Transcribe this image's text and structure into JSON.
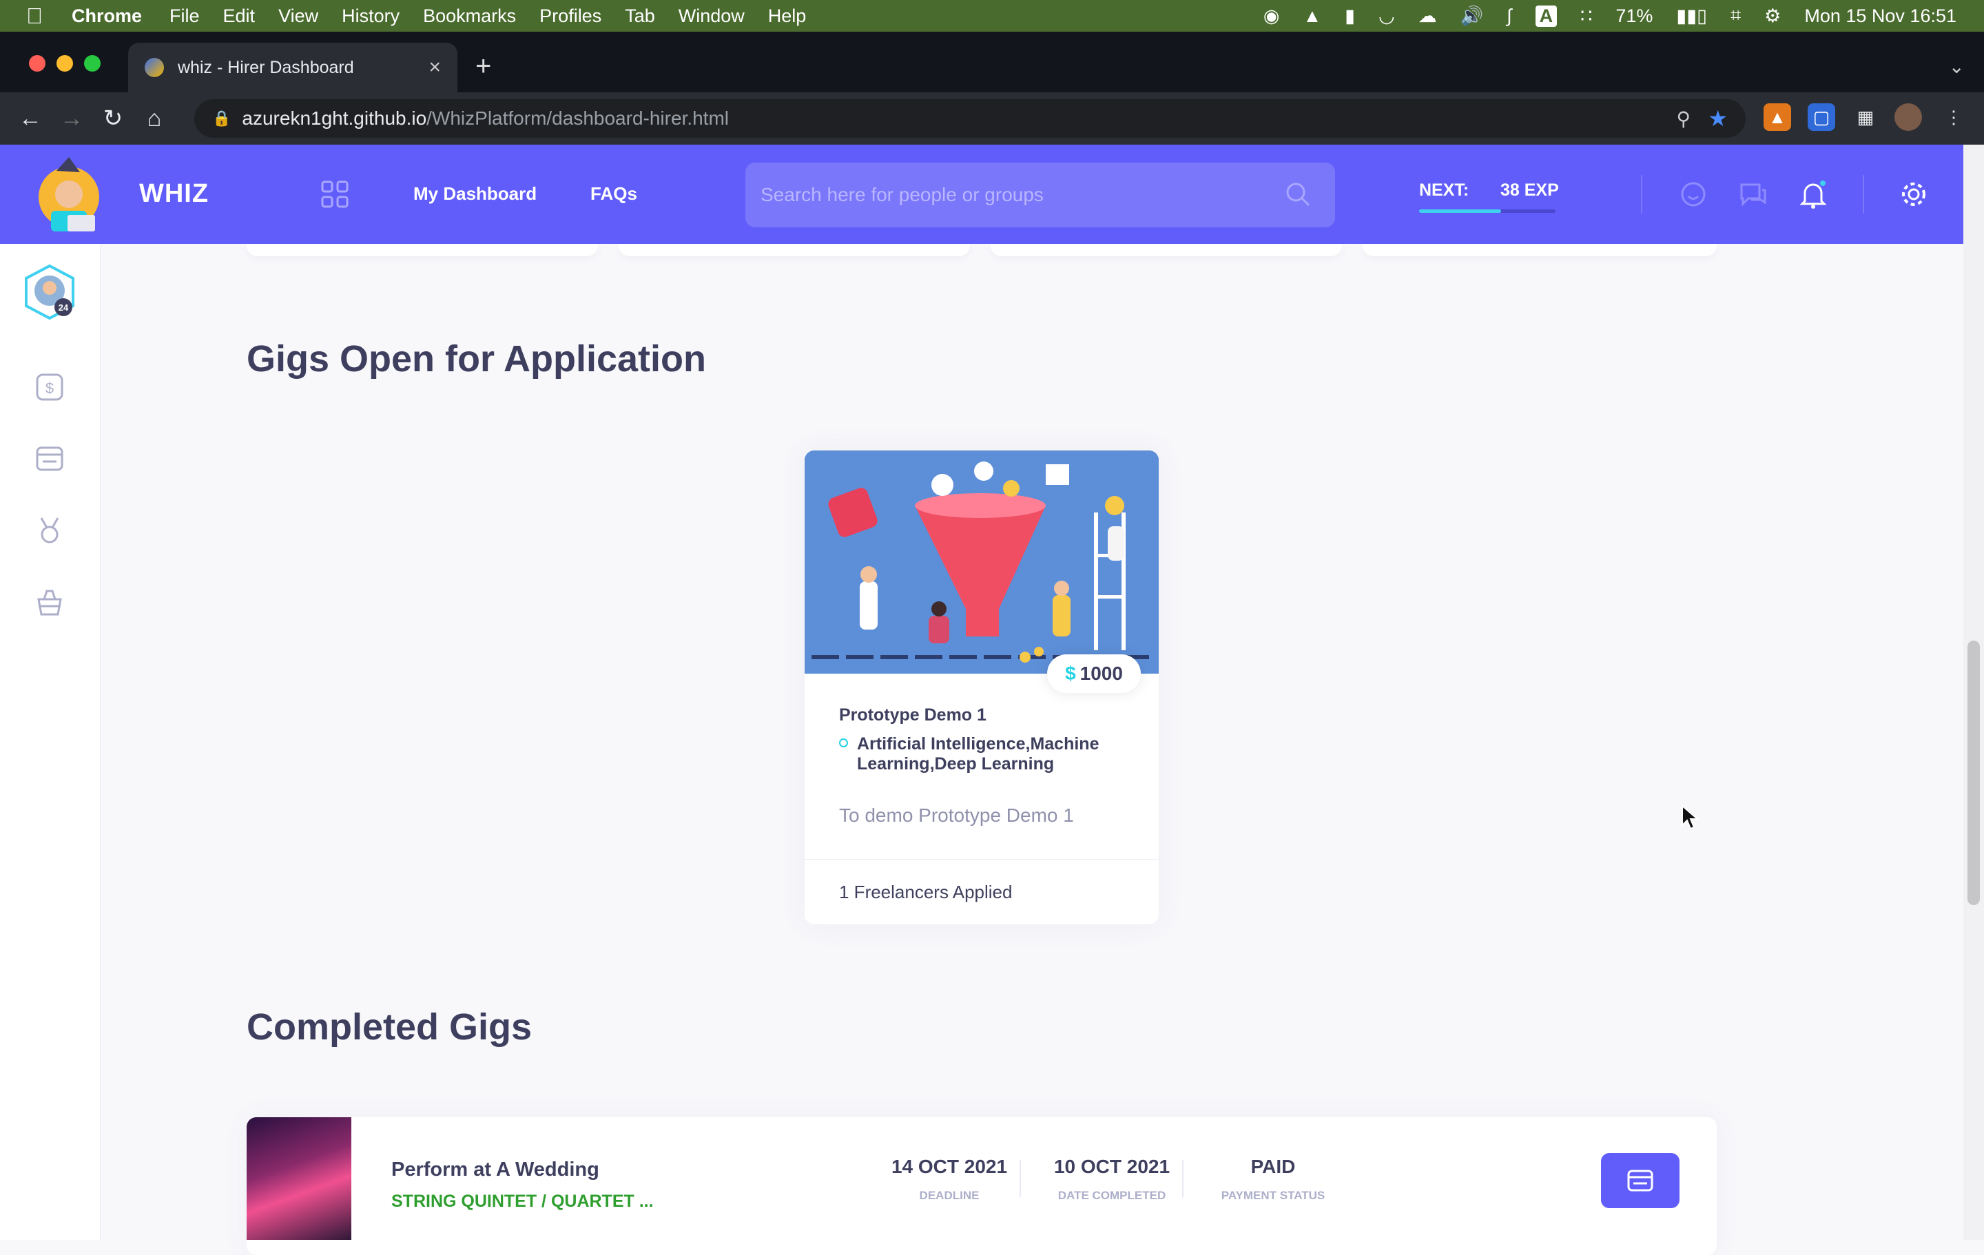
{
  "menubar": {
    "app": "Chrome",
    "items": [
      "File",
      "Edit",
      "View",
      "History",
      "Bookmarks",
      "Profiles",
      "Tab",
      "Window",
      "Help"
    ],
    "battery": "71%",
    "datetime": "Mon 15 Nov  16:51"
  },
  "browser": {
    "tab_title": "whiz - Hirer Dashboard",
    "url_host": "azurekn1ght.github.io",
    "url_path": "/WhizPlatform/dashboard-hirer.html"
  },
  "header": {
    "brand": "WHIZ",
    "nav": {
      "dashboard": "My Dashboard",
      "faqs": "FAQs"
    },
    "search_placeholder": "Search here for people or groups",
    "next_label": "NEXT:",
    "exp_label": "38 EXP",
    "exp_progress": 0.6
  },
  "sidebar": {
    "avatar_level": "24"
  },
  "sections": {
    "open_title": "Gigs Open for Application",
    "completed_title": "Completed Gigs"
  },
  "gig": {
    "currency": "$",
    "price": "1000",
    "title": "Prototype Demo 1",
    "tags": "Artificial Intelligence,Machine Learning,Deep Learning",
    "description": "To demo Prototype Demo 1",
    "applied": "1 Freelancers Applied"
  },
  "completed": {
    "title": "Perform at A Wedding",
    "category": "STRING QUINTET / QUARTET ...",
    "deadline": "14 OCT 2021",
    "deadline_label": "DEADLINE",
    "completed_date": "10 OCT 2021",
    "completed_label": "DATE COMPLETED",
    "payment": "PAID",
    "payment_label": "PAYMENT STATUS"
  },
  "colors": {
    "brand": "#615dfa",
    "accent": "#23d2e2",
    "text": "#3e3f5e",
    "category": "#2e9e2e"
  }
}
